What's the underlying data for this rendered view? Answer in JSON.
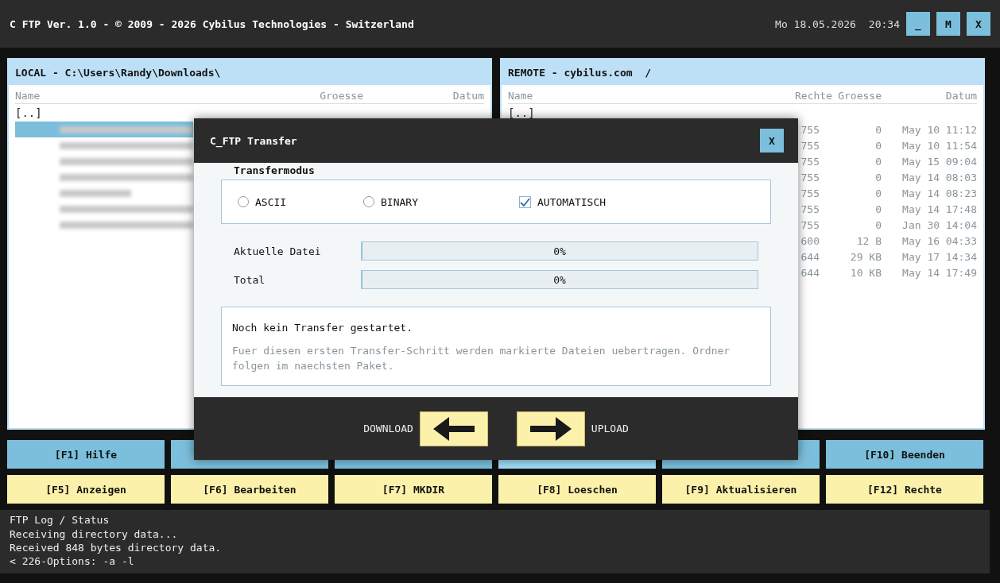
{
  "title_bar": {
    "title": "C FTP Ver. 1.0 - © 2009 - 2026 Cybilus Technologies - Switzerland",
    "date": "Mo 18.05.2026",
    "time": "20:34",
    "buttons": [
      "_",
      "M",
      "X"
    ]
  },
  "local": {
    "header": "LOCAL - C:\\Users\\Randy\\Downloads\\",
    "columns": [
      "Name",
      "Groesse",
      "Datum"
    ],
    "parent": "[..]",
    "rows": [
      {
        "selected": true
      },
      {
        "selected": false
      },
      {
        "selected": false
      },
      {
        "selected": false
      },
      {
        "selected": false
      },
      {
        "selected": false
      },
      {
        "selected": false
      }
    ]
  },
  "remote": {
    "header": "REMOTE - cybilus.com  /",
    "columns": [
      "Name",
      "Rechte",
      "Groesse",
      "Datum"
    ],
    "parent": "[..]",
    "rows": [
      {
        "rechte": "755",
        "groesse": "0",
        "datum": "May 10 11:12"
      },
      {
        "rechte": "755",
        "groesse": "0",
        "datum": "May 10 11:54"
      },
      {
        "rechte": "755",
        "groesse": "0",
        "datum": "May 15 09:04"
      },
      {
        "rechte": "755",
        "groesse": "0",
        "datum": "May 14 08:03"
      },
      {
        "rechte": "755",
        "groesse": "0",
        "datum": "May 14 08:23"
      },
      {
        "rechte": "755",
        "groesse": "0",
        "datum": "May 14 17:48"
      },
      {
        "rechte": "755",
        "groesse": "0",
        "datum": "Jan 30 14:04"
      },
      {
        "rechte": "600",
        "groesse": "12 B",
        "datum": "May 16 04:33"
      },
      {
        "rechte": "644",
        "groesse": "29 KB",
        "datum": "May 17 14:34"
      },
      {
        "rechte": "644",
        "groesse": "10 KB",
        "datum": "May 14 17:49"
      }
    ]
  },
  "function_keys_top": [
    {
      "label": "[F1] Hilfe",
      "selected": false
    },
    {
      "selected": false
    },
    {
      "selected": false
    },
    {
      "selected": true
    },
    {
      "selected": false
    },
    {
      "label": "[F10] Beenden",
      "selected": false
    }
  ],
  "function_keys_bottom": [
    "[F5] Anzeigen",
    "[F6] Bearbeiten",
    "[F7] MKDIR",
    "[F8] Loeschen",
    "[F9] Aktualisieren",
    "[F12] Rechte"
  ],
  "log": {
    "title": "FTP Log / Status",
    "lines": [
      "Receiving directory data...",
      "Received 848 bytes directory data.",
      "< 226-Options: -a -l"
    ]
  },
  "dialog": {
    "title": "C_FTP Transfer",
    "close": "X",
    "mode_label": "Transfermodus",
    "modes": [
      {
        "kind": "radio",
        "label": "ASCII",
        "checked": false
      },
      {
        "kind": "radio",
        "label": "BINARY",
        "checked": false
      },
      {
        "kind": "checkbox",
        "label": "AUTOMATISCH",
        "checked": true
      }
    ],
    "progress": [
      {
        "label": "Aktuelle Datei",
        "level": 0,
        "reading": "0%"
      },
      {
        "label": "Total",
        "level": 0,
        "reading": "0%"
      }
    ],
    "message": "Noch kein Transfer gestartet.",
    "detail": "Fuer diesen ersten Transfer-Schritt werden markierte Dateien uebertragen. Ordner folgen im naechsten Paket.",
    "download": "DOWNLOAD",
    "upload": "UPLOAD"
  }
}
